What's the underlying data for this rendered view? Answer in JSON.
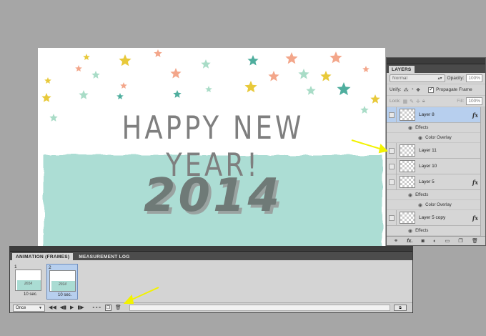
{
  "canvas": {
    "greeting": "HAPPY NEW YEAR!",
    "year": "2014",
    "colors": {
      "band": "#a8dcd2",
      "text": "#7f7f7f",
      "star_teal": "#4fae9e",
      "star_yellow": "#e8c93a",
      "star_peach": "#f3a68a",
      "star_mint": "#a9dcc7"
    }
  },
  "layers_panel": {
    "tab": "LAYERS",
    "blend_mode": "Normal",
    "opacity_label": "Opacity:",
    "opacity_value": "100%",
    "unify_label": "Unify:",
    "propagate_label": "Propagate Frame",
    "lock_label": "Lock:",
    "fill_label": "Fill:",
    "fill_value": "100%",
    "layers": [
      {
        "name": "Layer 8",
        "active": true,
        "fx": "fx"
      },
      {
        "name": "Layer 11"
      },
      {
        "name": "Layer 10"
      },
      {
        "name": "Layer 5",
        "fx": "fx"
      },
      {
        "name": "Layer 5 copy",
        "fx": "fx"
      }
    ],
    "effects_label": "Effects",
    "color_overlay_label": "Color Overlay"
  },
  "animation_panel": {
    "tabs": [
      "ANIMATION (FRAMES)",
      "MEASUREMENT LOG"
    ],
    "frames": [
      {
        "number": "1",
        "delay": "10 sec.",
        "selected": false
      },
      {
        "number": "2",
        "delay": "10 sec.",
        "selected": true
      }
    ],
    "loop": "Once",
    "thumb_year": "2014"
  },
  "annotation_color": "#f2f200"
}
